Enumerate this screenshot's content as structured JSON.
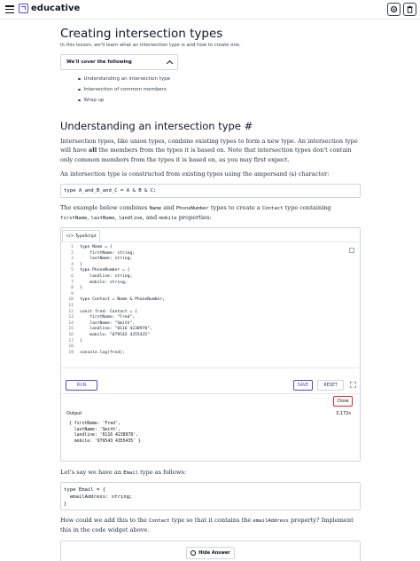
{
  "app": {
    "brand": "educative",
    "accent": "#4f46e5",
    "danger": "#dc2626"
  },
  "topbar": {
    "menu_icon": "hamburger-menu-icon",
    "settings_icon": "gear-icon",
    "trash_icon": "trash-icon"
  },
  "lesson": {
    "title": "Creating intersection types",
    "intro": "In this lesson, we'll learn what an intersection type is and how to create one.",
    "toc_title": "We'll cover the following",
    "toc_items": [
      "Understanding an intersection type",
      "Intersection of common members",
      "Wrap up"
    ]
  },
  "section": {
    "title": "Understanding an intersection type #",
    "p1_a": "Intersection types, like union types, combine existing types to form a new type. An intersection type will have",
    "p1_bold": "all",
    "p1_b": "the members from the types it is based on. Note that intersection types don't contain only common members from the types it is based on, as you may first expect.",
    "p2_a": "An intersection type is constructed from existing types using the ampersand (",
    "p2_code": "&",
    "p2_b": ") character:",
    "code1": "type A_and_B_and_C = A & B & C;",
    "p3_a": "The example below combines",
    "p3_code1": "Name",
    "p3_and": "and",
    "p3_code2": "PhoneNumber",
    "p3_b": "types to create a",
    "p3_code3": "Contact",
    "p3_c": "type containing",
    "p3_code4": "firstName",
    "p3_comma1": ",",
    "p3_code5": "lastName",
    "p3_comma2": ",",
    "p3_code6": "landline",
    "p3_comma3": ", and",
    "p3_code7": "mobile",
    "p3_d": "properties:"
  },
  "widget": {
    "language_tab": "</> TypeScript",
    "code_lines": [
      "type Name = {",
      "    firstName: string;",
      "    lastName: string;",
      "}",
      "type PhoneNumber = {",
      "    landline: string;",
      "    mobile: string;",
      "}",
      "",
      "type Contact = Name & PhoneNumber;",
      "",
      "const fred: Contact = {",
      "    firstName: \"Fred\",",
      "    lastName: \"Smith\",",
      "    landline: \"0116 4238978\",",
      "    mobile: \"079543 4355435\"",
      "}",
      "",
      "console.log(fred);"
    ],
    "run_label": "RUN",
    "save_label": "SAVE",
    "reset_label": "RESET",
    "close_label": "Close",
    "output_label": "Output",
    "output_time": "3.172s",
    "output_text": "{ firstName: 'Fred',\n  lastName: 'Smith',\n  landline: '0116 4238978',\n  mobile: '079543 4355435' }"
  },
  "after": {
    "p4_a": "Let's say we have an",
    "p4_code": "Email",
    "p4_b": "type as follows:",
    "code2": "type Email = {\n  emailAddress: string;\n}",
    "p5_a": "How could we add this to the",
    "p5_code1": "Contact",
    "p5_b": "type so that it contains the",
    "p5_code2": "emailAddress",
    "p5_c": "property? Implement this in the code widget above.",
    "hide_answer": "Hide Answer"
  }
}
